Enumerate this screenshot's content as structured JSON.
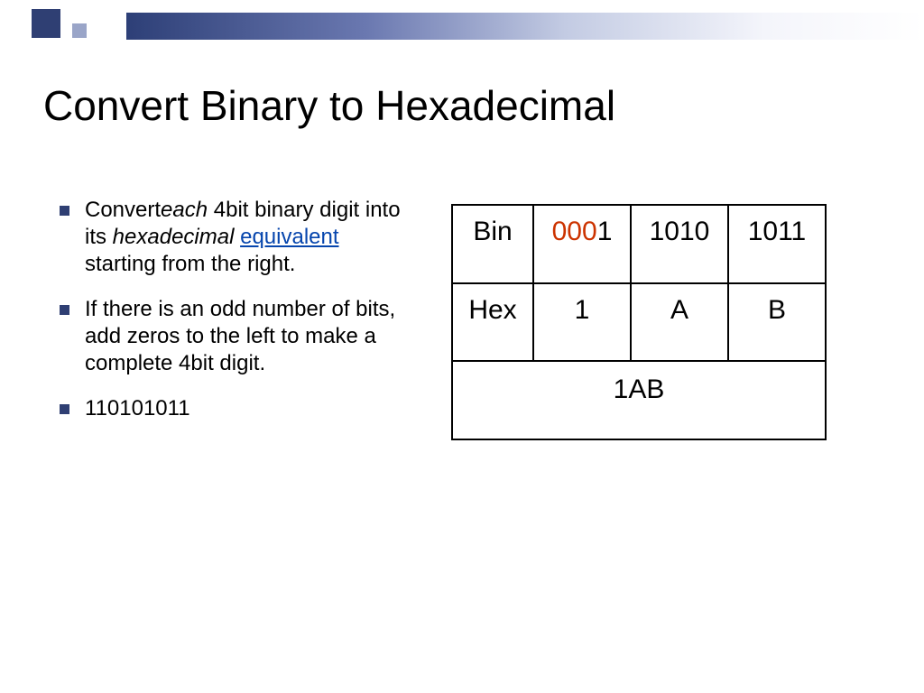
{
  "title": "Convert Binary to Hexadecimal",
  "bullets": {
    "b1": {
      "t1": "Convert",
      "t2": "each",
      "t3": " 4bit binary digit into its ",
      "t4": "hexadecimal",
      "t5": " ",
      "t6": "equivalent",
      "t7": " starting from the right."
    },
    "b2": "If there is an odd number of bits, add zeros to the left to make a complete 4bit digit.",
    "b3": "110101011"
  },
  "table": {
    "row1": {
      "label": "Bin",
      "c1_red": "000",
      "c1_rest": "1",
      "c2": "1010",
      "c3": "1011"
    },
    "row2": {
      "label": "Hex",
      "c1": "1",
      "c2": "A",
      "c3": "B"
    },
    "result": "1AB"
  }
}
